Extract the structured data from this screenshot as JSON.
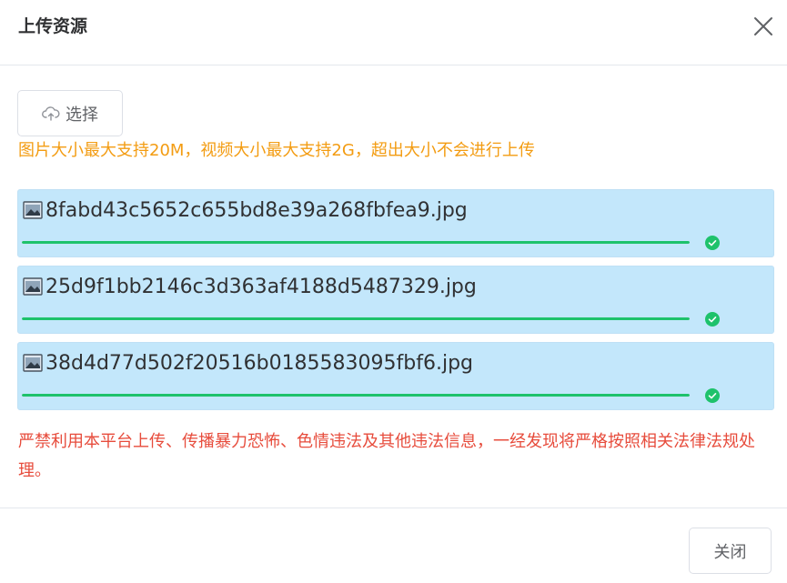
{
  "dialog": {
    "title": "上传资源"
  },
  "upload": {
    "select_label": "选择",
    "size_tip": "图片大小最大支持20M，视频大小最大支持2G，超出大小不会进行上传"
  },
  "files": [
    {
      "name": "8fabd43c5652c655bd8e39a268fbfea9.jpg",
      "progress": 1.0,
      "status": "success"
    },
    {
      "name": "25d9f1bb2146c3d363af4188d5487329.jpg",
      "progress": 1.0,
      "status": "success"
    },
    {
      "name": "38d4d77d502f20516b0185583095fbf6.jpg",
      "progress": 1.0,
      "status": "success"
    }
  ],
  "warning": "严禁利用本平台上传、传播暴力恐怖、色情违法及其他违法信息，一经发现将严格按照相关法律法规处理。",
  "footer": {
    "close_label": "关闭"
  },
  "colors": {
    "progress": "#1ec26b",
    "file_bg": "#c3e7fb",
    "size_tip": "#f39c12",
    "warning": "#e74c3c"
  }
}
